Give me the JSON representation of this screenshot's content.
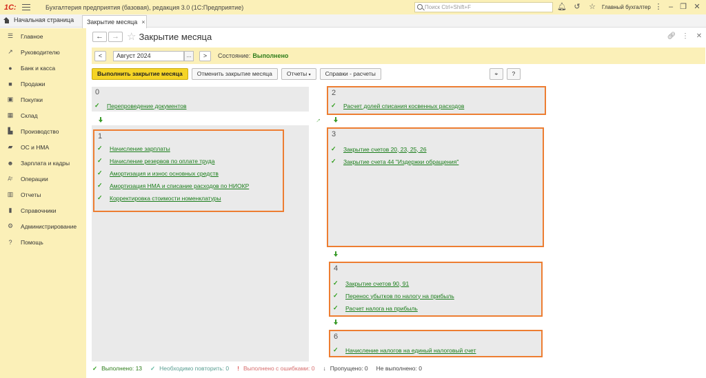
{
  "app": {
    "logo": "1С:",
    "title": "Бухгалтерия предприятия (базовая), редакция 3.0  (1С:Предприятие)",
    "search_placeholder": "Поиск Ctrl+Shift+F",
    "user": "Главный бухгалтер"
  },
  "tabs": {
    "home": "Начальная страница",
    "active": "Закрытие месяца",
    "close": "×"
  },
  "sidebar": {
    "items": [
      {
        "label": "Главное",
        "icon": "menu-lines-icon"
      },
      {
        "label": "Руководителю",
        "icon": "trend-icon"
      },
      {
        "label": "Банк и касса",
        "icon": "coins-icon"
      },
      {
        "label": "Продажи",
        "icon": "bag-icon"
      },
      {
        "label": "Покупки",
        "icon": "cart-icon"
      },
      {
        "label": "Склад",
        "icon": "boxes-icon"
      },
      {
        "label": "Производство",
        "icon": "factory-icon"
      },
      {
        "label": "ОС и НМА",
        "icon": "truck-icon"
      },
      {
        "label": "Зарплата и кадры",
        "icon": "person-icon"
      },
      {
        "label": "Операции",
        "icon": "operations-icon"
      },
      {
        "label": "Отчеты",
        "icon": "chart-icon"
      },
      {
        "label": "Справочники",
        "icon": "book-icon"
      },
      {
        "label": "Администрирование",
        "icon": "gear-icon"
      },
      {
        "label": "Помощь",
        "icon": "help-icon"
      }
    ]
  },
  "page": {
    "title": "Закрытие месяца",
    "back": "←",
    "forward": "→"
  },
  "period": {
    "prev": "<",
    "month": "Август 2024",
    "dots": "...",
    "next": ">",
    "status_label": "Состояние:",
    "status_value": "Выполнено"
  },
  "toolbar": {
    "run": "Выполнить закрытие месяца",
    "cancel": "Отменить закрытие месяца",
    "reports": "Отчеты",
    "references": "Справки - расчеты",
    "help": "?"
  },
  "panels": {
    "p0": {
      "num": "0",
      "steps": [
        "Перепроведение документов"
      ]
    },
    "p1": {
      "num": "1",
      "steps": [
        "Начисление зарплаты",
        "Начисление резервов по оплате труда",
        "Амортизация и износ основных средств",
        "Амортизация НМА и списание расходов по НИОКР",
        "Корректировка стоимости номенклатуры"
      ]
    },
    "p2": {
      "num": "2",
      "steps": [
        "Расчет долей списания косвенных расходов"
      ]
    },
    "p3": {
      "num": "3",
      "steps": [
        "Закрытие счетов 20, 23, 25, 26",
        "Закрытие счета 44 \"Издержки обращения\""
      ]
    },
    "p4": {
      "num": "4",
      "steps": [
        "Закрытие счетов 90, 91",
        "Перенос убытков по налогу на прибыль",
        "Расчет налога на прибыль"
      ]
    },
    "p6": {
      "num": "6",
      "steps": [
        "Начисление налогов на единый налоговый счет"
      ]
    }
  },
  "footer": {
    "done": "Выполнено: 13",
    "repeat": "Необходимо повторить: 0",
    "errors": "Выполнено с ошибками: 0",
    "skipped": "Пропущено: 0",
    "not_done": "Не выполнено: 0"
  },
  "colors": {
    "accent_yellow": "#fbf0b8",
    "primary_button": "#f5d426",
    "highlight_border": "#ed7d31",
    "success_green": "#2e7d1b"
  }
}
